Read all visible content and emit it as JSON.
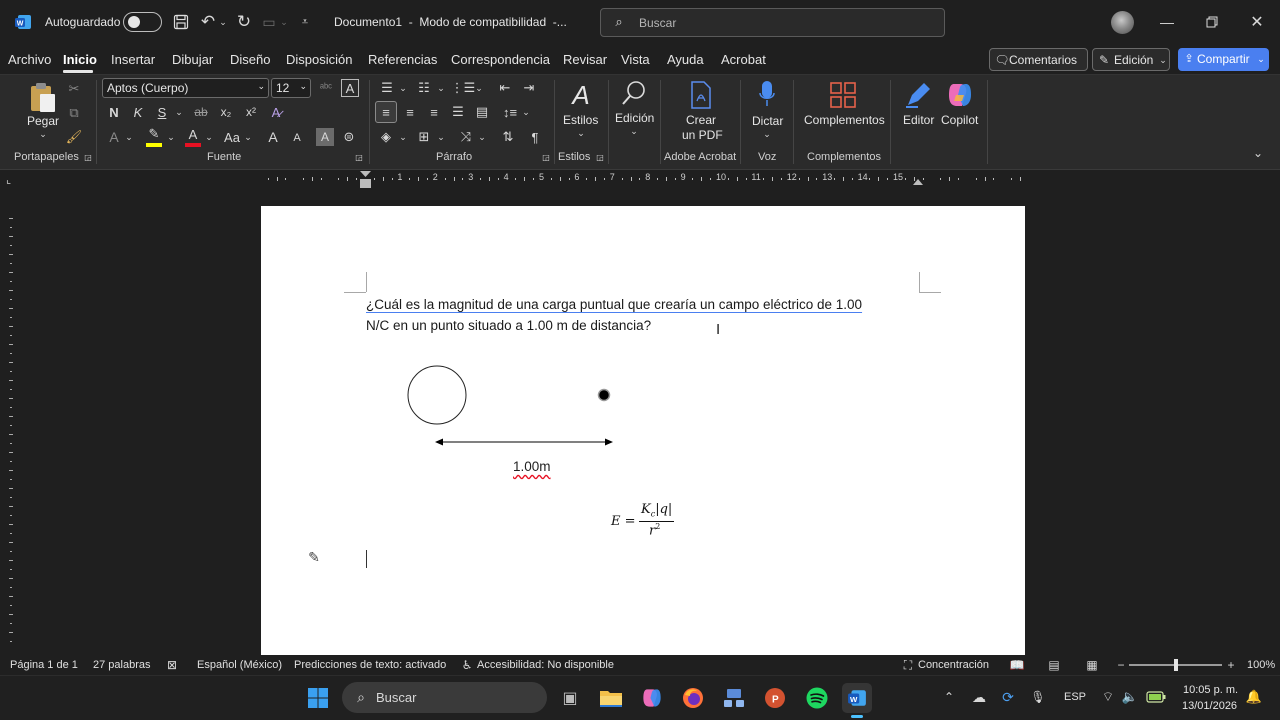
{
  "titlebar": {
    "autosave_label": "Autoguardado",
    "doc_title": "Documento1  -  Modo de compatibilidad  -...",
    "search_placeholder": "Buscar"
  },
  "menu": {
    "archivo": "Archivo",
    "tabs": [
      "Inicio",
      "Insertar",
      "Dibujar",
      "Diseño",
      "Disposición",
      "Referencias",
      "Correspondencia",
      "Revisar",
      "Vista",
      "Ayuda",
      "Acrobat"
    ],
    "comentarios": "Comentarios",
    "edicion": "Edición",
    "compartir": "Compartir"
  },
  "ribbon": {
    "pegar": "Pegar",
    "portapapeles": "Portapapeles",
    "font_name": "Aptos (Cuerpo)",
    "font_size": "12",
    "bold": "N",
    "italic": "K",
    "underline": "S",
    "strike": "ab",
    "subscript": "x₂",
    "superscript": "x²",
    "grow": "A",
    "shrink": "A",
    "change_case": "Aa",
    "fuente": "Fuente",
    "parrafo": "Párrafo",
    "estilos": "Estilos",
    "estilos_group": "Estilos",
    "edicion": "Edición",
    "crear_pdf_1": "Crear",
    "crear_pdf_2": "un PDF",
    "adobe_acrobat": "Adobe Acrobat",
    "dictar": "Dictar",
    "voz": "Voz",
    "complementos": "Complementos",
    "complementos_group": "Complementos",
    "editor": "Editor",
    "copilot": "Copilot"
  },
  "ruler": {
    "labels": [
      "1",
      "2",
      "3",
      "4",
      "5",
      "6",
      "7",
      "8",
      "9",
      "10",
      "11",
      "12",
      "13",
      "14",
      "15"
    ]
  },
  "document": {
    "question_line1": "¿Cuál es la magnitud de una carga puntual que crearía un campo eléctrico de 1.00",
    "question_line2": "N/C en un punto situado a 1.00 m de distancia?",
    "distance_label": "1.00m",
    "formula_lhs": "E =",
    "formula_num": "K",
    "formula_sub": "c",
    "formula_num_rest": "|q|",
    "formula_den": "r",
    "formula_den_exp": "2"
  },
  "status": {
    "page": "Página 1 de 1",
    "words": "27 palabras",
    "language": "Español (México)",
    "predictions": "Predicciones de texto: activado",
    "accessibility": "Accesibilidad: No disponible",
    "focus": "Concentración",
    "zoom": "100%",
    "zoom_level": 1.0
  },
  "taskbar": {
    "search": "Buscar",
    "lang": "ESP",
    "time": "10:05 p. m.",
    "date": "13/01/2026"
  },
  "colors": {
    "word_blue": "#185abd",
    "share_blue": "#4a7ff0",
    "highlight_yellow": "#ffff00",
    "font_red": "#e81123"
  }
}
